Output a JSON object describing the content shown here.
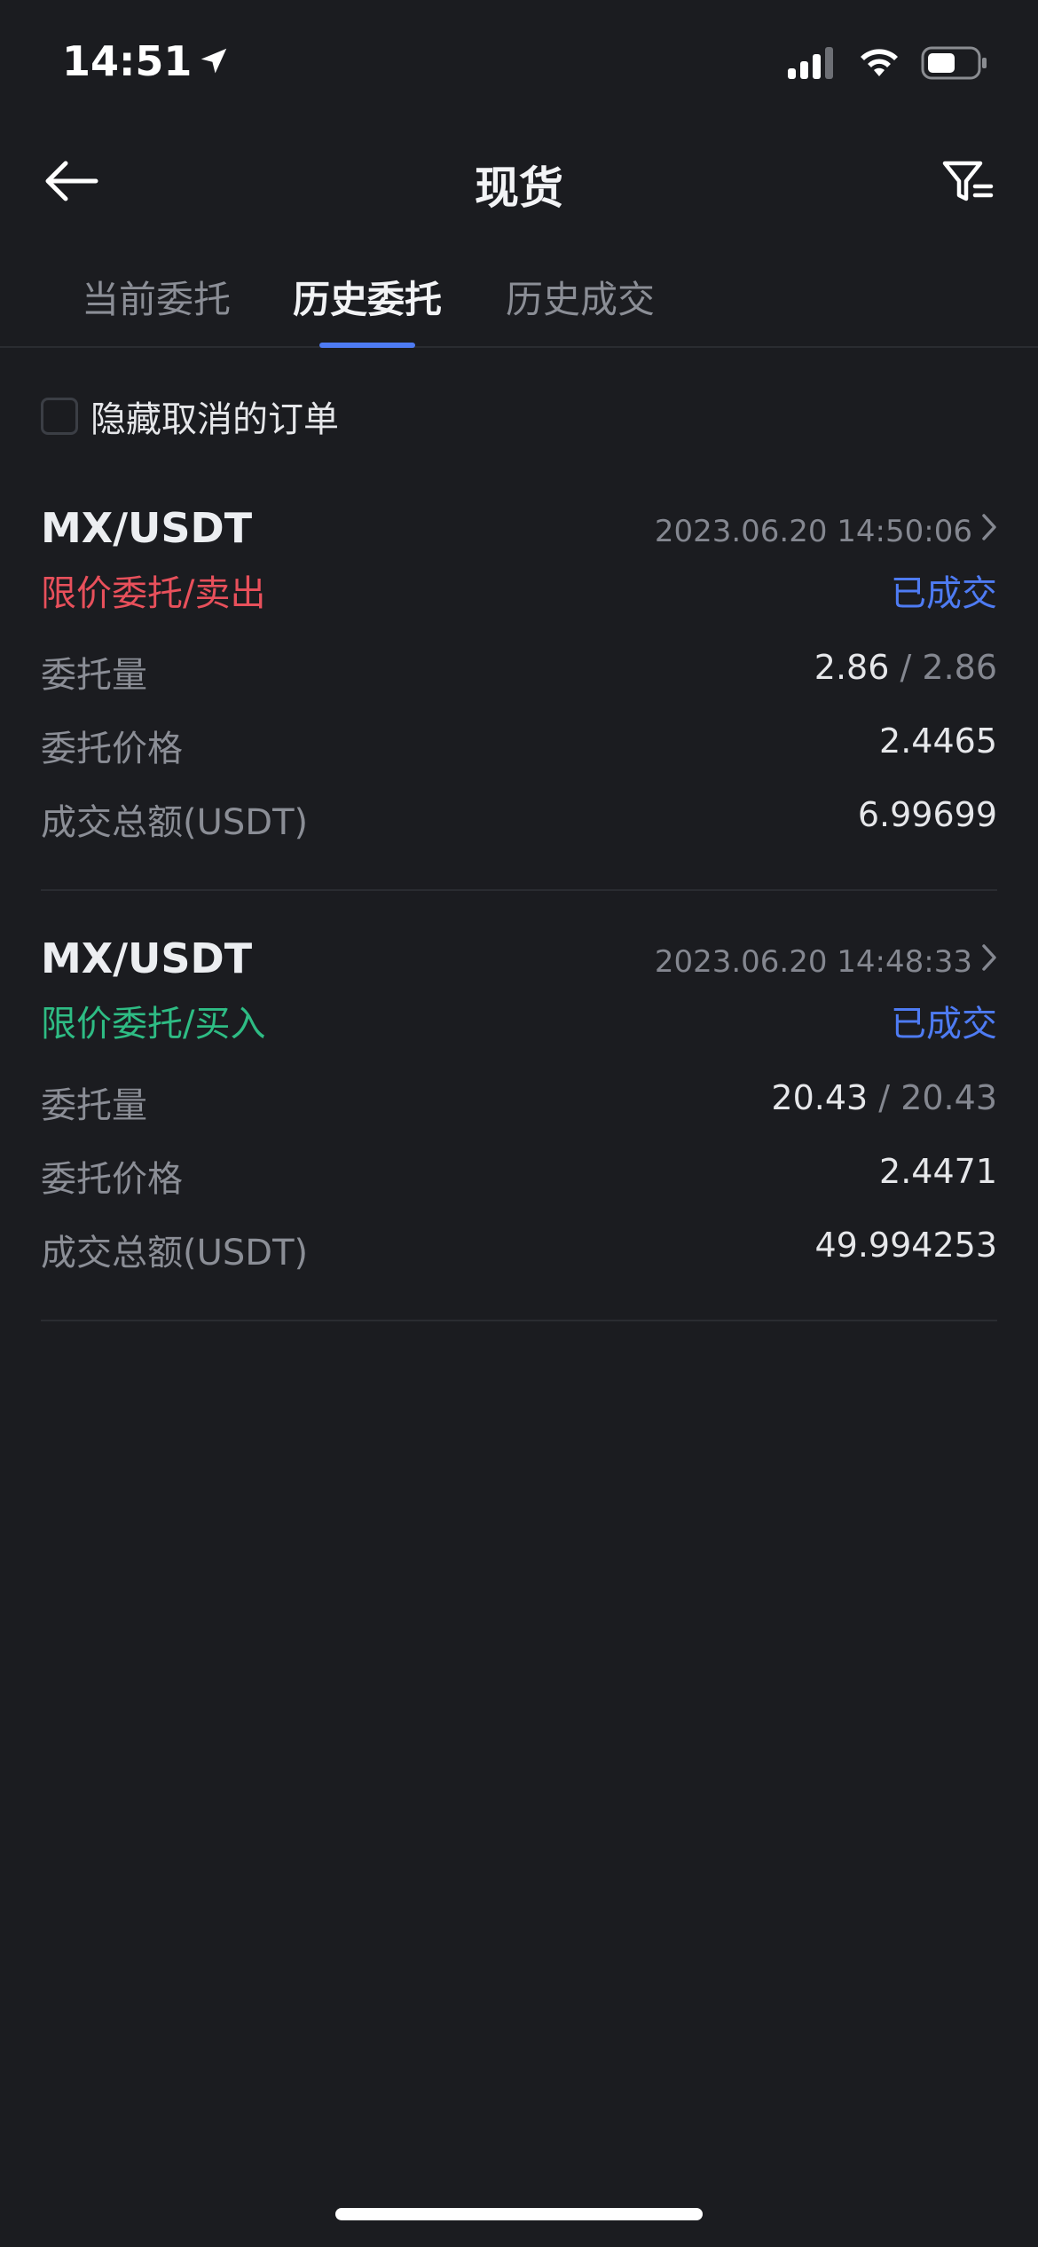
{
  "status_bar": {
    "time": "14:51"
  },
  "nav": {
    "title": "现货"
  },
  "tabs": [
    {
      "label": "当前委托",
      "active": false
    },
    {
      "label": "历史委托",
      "active": true
    },
    {
      "label": "历史成交",
      "active": false
    }
  ],
  "filter": {
    "hide_cancelled_label": "隐藏取消的订单",
    "checked": false
  },
  "orders": [
    {
      "pair": "MX/USDT",
      "time": "2023.06.20 14:50:06",
      "type": "限价委托/卖出",
      "side": "sell",
      "status": "已成交",
      "rows": {
        "qty_label": "委托量",
        "qty_filled": "2.86",
        "qty_sep": "/",
        "qty_total": "2.86",
        "price_label": "委托价格",
        "price": "2.4465",
        "amount_label": "成交总额(USDT)",
        "amount": "6.99699"
      }
    },
    {
      "pair": "MX/USDT",
      "time": "2023.06.20 14:48:33",
      "type": "限价委托/买入",
      "side": "buy",
      "status": "已成交",
      "rows": {
        "qty_label": "委托量",
        "qty_filled": "20.43",
        "qty_sep": "/",
        "qty_total": "20.43",
        "price_label": "委托价格",
        "price": "2.4471",
        "amount_label": "成交总额(USDT)",
        "amount": "49.994253"
      }
    }
  ],
  "colors": {
    "background": "#1b1c20",
    "accent": "#4e7bf3",
    "sell": "#e8505b",
    "buy": "#2ebc84"
  }
}
